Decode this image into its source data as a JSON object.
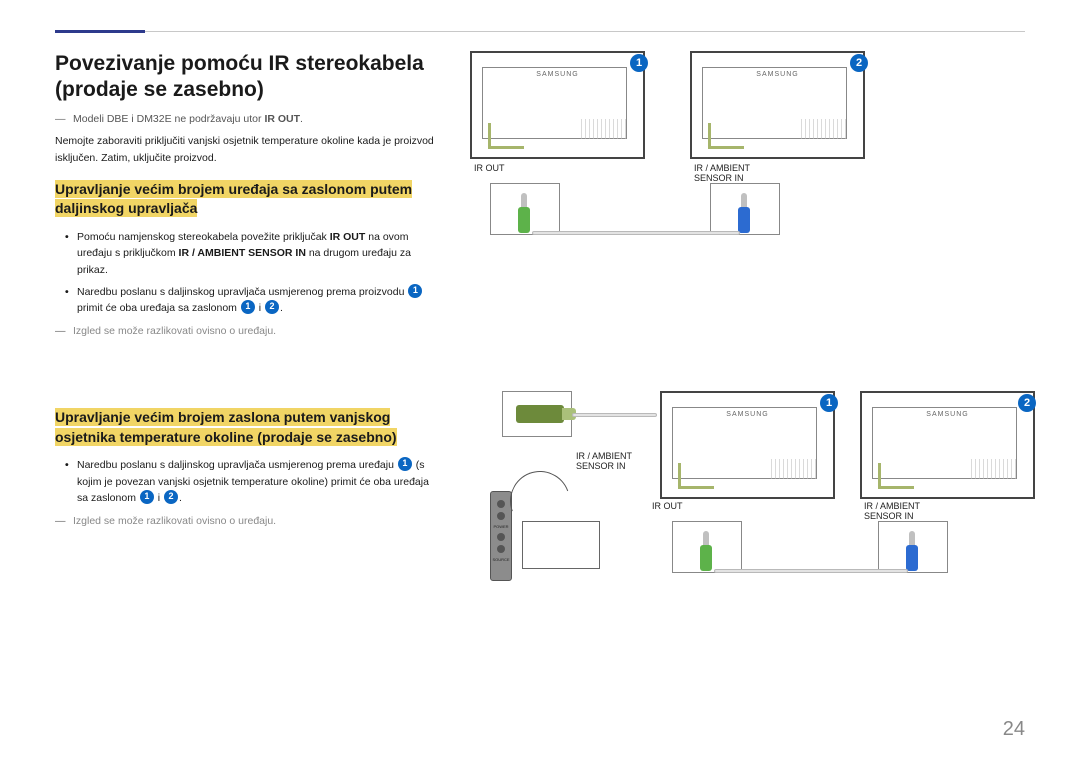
{
  "page_number": "24",
  "title": "Povezivanje pomoću IR stereokabela (prodaje se zasebno)",
  "note_models": "Modeli DBE i DM32E ne podržavaju utor ",
  "note_models_bold": "IR OUT",
  "note_models_tail": ".",
  "intro_body": "Nemojte zaboraviti priključiti vanjski osjetnik temperature okoline kada je proizvod isključen. Zatim, uključite proizvod.",
  "sub1": "Upravljanje većim brojem uređaja sa zaslonom putem daljinskog upravljača",
  "b1_pre": "Pomoću namjenskog stereokabela povežite priključak ",
  "b1_mid1": "IR OUT",
  "b1_mid2": " na ovom uređaju s priključkom ",
  "b1_mid3": "IR / AMBIENT SENSOR IN",
  "b1_tail": " na drugom uređaju za prikaz.",
  "b2_pre": "Naredbu poslanu s daljinskog upravljača usmjerenog prema proizvodu ",
  "b2_mid": " primit će oba uređaja sa zaslonom ",
  "b2_and": " i ",
  "b2_tail": ".",
  "note_look": "Izgled se može razlikovati ovisno o uređaju.",
  "sub2": "Upravljanje većim brojem zaslona putem vanjskog osjetnika temperature okoline (prodaje se zasebno)",
  "c1_pre": "Naredbu poslanu s daljinskog upravljača usmjerenog prema uređaju ",
  "c1_mid": " (s kojim je povezan vanjski osjetnik temperature okoline) primit će oba uređaja sa zaslonom ",
  "c1_and": " i ",
  "c1_tail": ".",
  "labels": {
    "ir_out": "IR OUT",
    "ir_ambient": "IR / AMBIENT SENSOR IN",
    "brand": "SAMSUNG",
    "power": "POWER",
    "source": "SOURCE"
  },
  "badges": {
    "one": "1",
    "two": "2"
  }
}
